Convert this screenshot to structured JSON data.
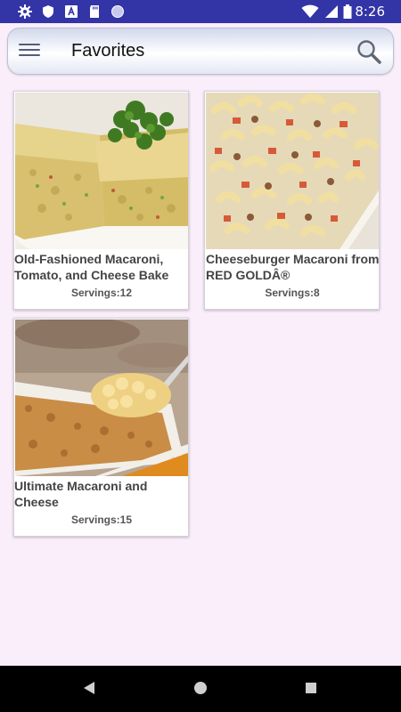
{
  "status_bar": {
    "time": "8:26",
    "left_icons": [
      "gear-icon",
      "shield-icon",
      "a-box-icon",
      "sd-card-icon",
      "circle-icon"
    ],
    "right_icons": [
      "wifi-icon",
      "signal-icon",
      "battery-icon"
    ]
  },
  "app_bar": {
    "title": "Favorites",
    "menu_icon": "hamburger-menu-icon",
    "search_icon": "search-icon"
  },
  "recipes": [
    {
      "title": "Old-Fashioned Macaroni, Tomato, and Cheese Bake",
      "servings": "Servings:12"
    },
    {
      "title": "Cheeseburger Macaroni from RED GOLDÂ®",
      "servings": "Servings:8"
    },
    {
      "title": "Ultimate Macaroni and Cheese",
      "servings": "Servings:15"
    }
  ],
  "nav_bar": {
    "buttons": [
      "back-icon",
      "home-icon",
      "recents-icon"
    ]
  },
  "colors": {
    "status_bar": "#3334a6",
    "background": "#fbeefb",
    "nav_bar": "#000000"
  }
}
